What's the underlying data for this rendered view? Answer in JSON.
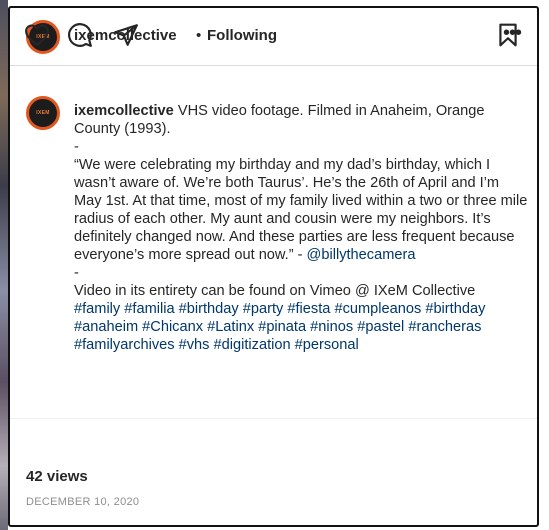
{
  "post": {
    "username": "ixemcollective",
    "header_separator": "•",
    "follow_status": "Following",
    "avatar_text": "IXEM",
    "more_icon": "ellipsis-horizontal-icon",
    "caption": {
      "username": "ixemcollective",
      "line1_text": "VHS video footage. Filmed in Anaheim, Orange County (1993).",
      "sep1": "-",
      "quote": "“We were celebrating my birthday and my dad’s birthday, which I wasn’t aware of. We’re both Taurus’. He’s the 26th of April and I’m May 1st. At that time, most of my family lived within a two or three mile radius of each other. My aunt and cousin were my neighbors. It’s definitely changed now. And these parties are less frequent because everyone’s more spread out now.” - ",
      "mention": "@billythecamera",
      "sep2": "-",
      "vimeo_line": "Video in its entirety can be found on Vimeo @ IXeM Collective",
      "hashtags": [
        "#family",
        "#familia",
        "#birthday",
        "#party",
        "#fiesta",
        "#cumpleanos",
        "#birthday",
        "#anaheim",
        "#Chicanx",
        "#Latinx",
        "#pinata",
        "#ninos",
        "#pastel",
        "#rancheras",
        "#familyarchives",
        "#vhs",
        "#digitization",
        "#personal"
      ]
    },
    "actions": {
      "like_icon": "heart-icon",
      "comment_icon": "comment-icon",
      "share_icon": "paper-plane-icon",
      "save_icon": "bookmark-icon"
    },
    "views": "42 views",
    "date": "DECEMBER 10, 2020"
  },
  "colors": {
    "text": "#262626",
    "link": "#00376b",
    "muted": "#8e8e8e",
    "avatar_ring": "#e1571f",
    "avatar_bg": "#1c1c1c"
  }
}
